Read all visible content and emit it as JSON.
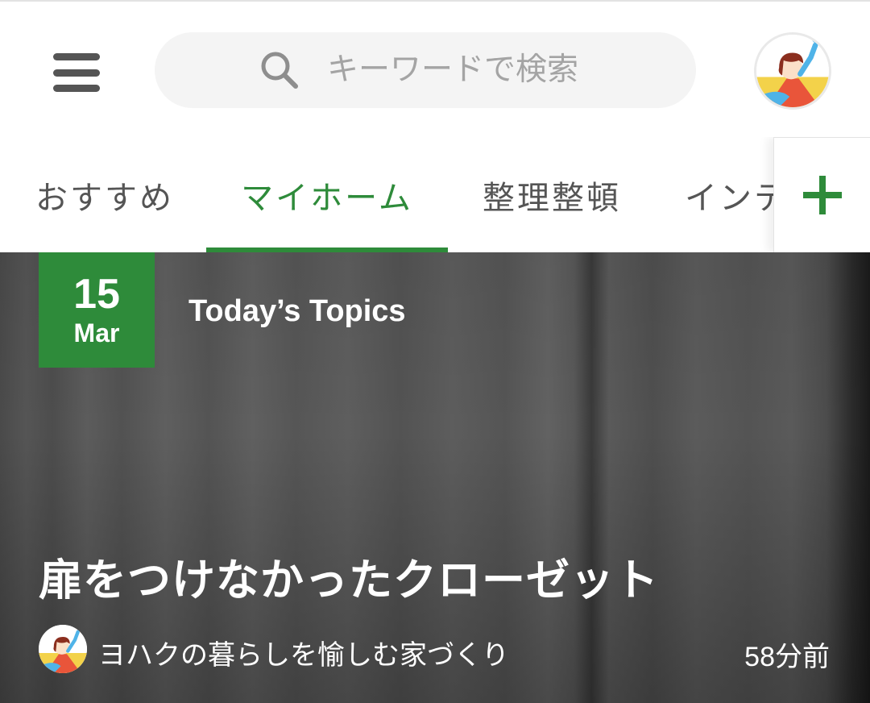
{
  "search": {
    "placeholder": "キーワードで検索",
    "icon": "search-icon"
  },
  "header": {
    "menu_icon": "hamburger-menu-icon",
    "avatar_icon": "user-avatar"
  },
  "tabs": [
    {
      "label": "おすすめ",
      "active": false
    },
    {
      "label": "マイホーム",
      "active": true
    },
    {
      "label": "整理整頓",
      "active": false
    },
    {
      "label": "インテ",
      "active": false
    }
  ],
  "add_tab_icon": "plus-icon",
  "topic": {
    "date_day": "15",
    "date_month": "Mar",
    "heading": "Today’s Topics",
    "title": "扉をつけなかったクローゼット",
    "author": "ヨハクの暮らしを愉しむ家づくり",
    "time": "58分前"
  },
  "colors": {
    "accent": "#2e8b3a",
    "text_gray": "#555555",
    "search_bg": "#f4f4f4"
  }
}
